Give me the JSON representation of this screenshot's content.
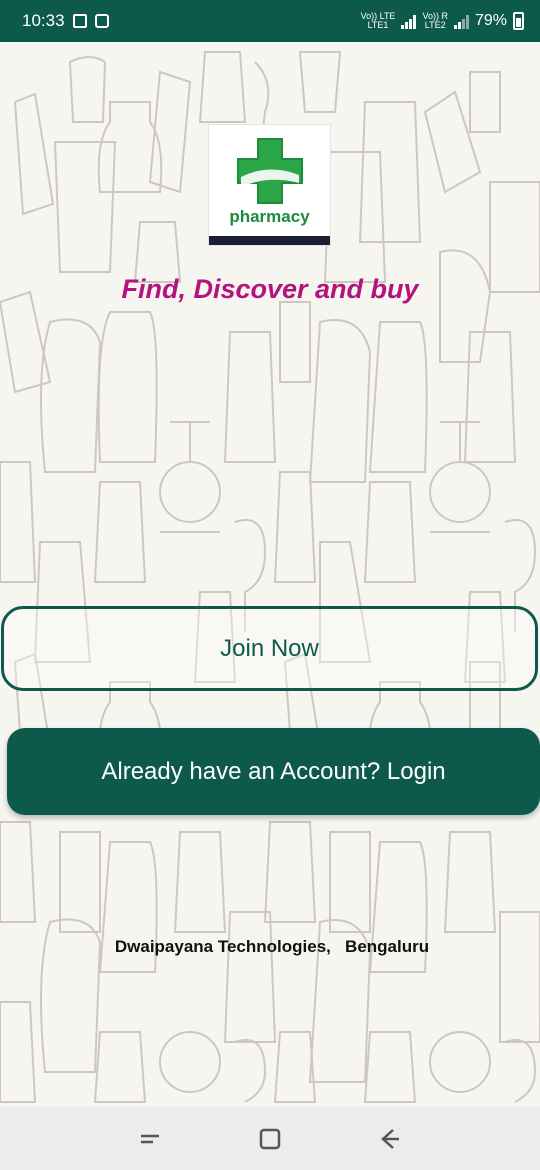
{
  "status_bar": {
    "time": "10:33",
    "network_1": "Vo)) LTE",
    "network_1_sub": "LTE1",
    "network_2": "Vo)) R",
    "network_2_sub": "LTE2",
    "battery": "79%",
    "battery_level": 0.79
  },
  "logo": {
    "text": "pharmacy",
    "colors": {
      "cross": "#2aa647",
      "text": "#1d8a3c",
      "strip": "#1a1f33"
    }
  },
  "tagline": "Find, Discover and buy",
  "buttons": {
    "join_label": "Join Now",
    "login_label": "Already have an Account? Login"
  },
  "footer": {
    "company": "Dwaipayana Technologies,   Bengaluru"
  },
  "nav": {
    "icons": [
      "recent-apps-icon",
      "home-icon",
      "back-icon"
    ]
  },
  "colors": {
    "primary": "#0d5a4c",
    "accent": "#b3137c",
    "background": "#f7f5f0"
  }
}
